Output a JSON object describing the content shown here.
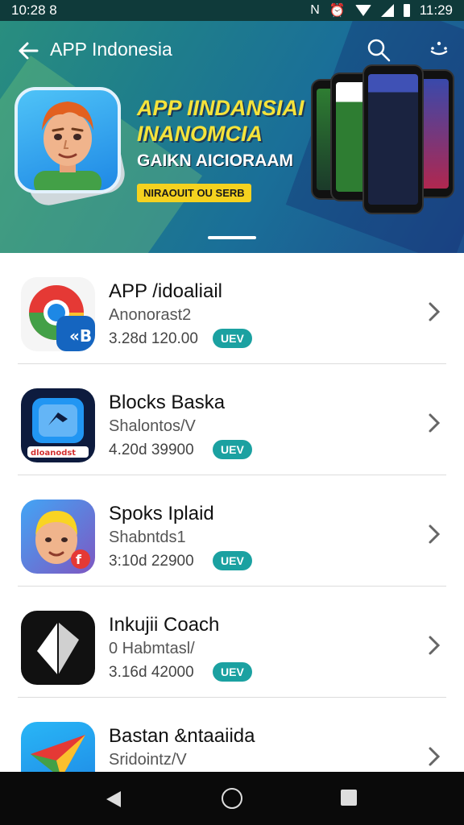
{
  "status_bar": {
    "time_left": "10:28 8",
    "time_right": "11:29",
    "icons": [
      "nfc-icon",
      "alarm-icon",
      "wifi-icon",
      "signal-icon",
      "battery-icon"
    ]
  },
  "toolbar": {
    "title": "APP Indonesia",
    "back_icon": "arrow-left-icon",
    "search_icon": "search-icon",
    "more_icon": "more-icon"
  },
  "banner": {
    "line1": "APP IINDANSIAI",
    "line2": "INANOMCIA",
    "line3": "GAIKN AICIORAAM",
    "badge": "NIRAOUIT OU SERB"
  },
  "apps": [
    {
      "title": "APP /idoaliail",
      "subtitle": "Anonorast2",
      "meta": "3.28d 120.00",
      "badge": "UEV",
      "icon": "chrome-like-icon"
    },
    {
      "title": "Blocks Baska",
      "subtitle": "Shalontos/V",
      "meta": "4.20d 39900",
      "badge": "UEV",
      "icon": "blocks-icon"
    },
    {
      "title": "Spoks Iplaid",
      "subtitle": "Shabntds1",
      "meta": "3:10d 22900",
      "badge": "UEV",
      "icon": "avatar-app-icon"
    },
    {
      "title": "Inkujii Coach",
      "subtitle": "0 Habmtasl/",
      "meta": "3.16d 42000",
      "badge": "UEV",
      "icon": "paper-fold-icon"
    },
    {
      "title": "Bastan &ntaaiida",
      "subtitle": "Sridointz/V",
      "meta": "",
      "badge": "",
      "icon": "paper-plane-icon"
    }
  ],
  "colors": {
    "badge": "#1ba1a1",
    "banner_yellow": "#f5e33b",
    "navbar": "#0a0a0a"
  }
}
